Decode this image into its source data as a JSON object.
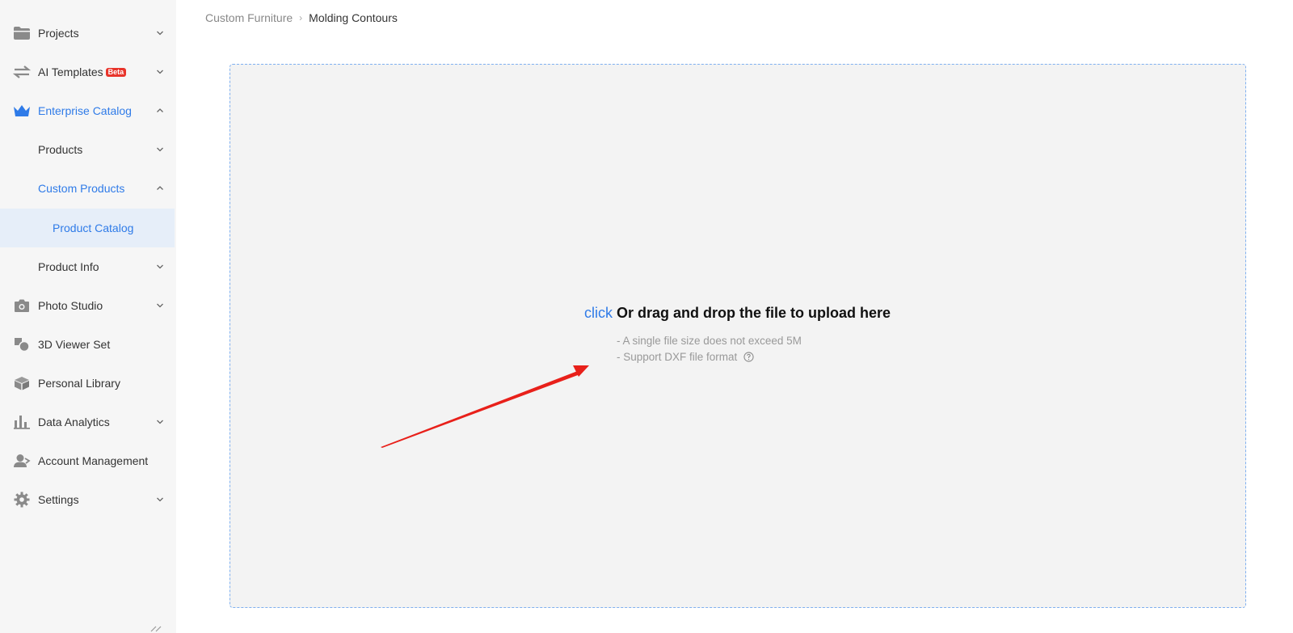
{
  "sidebar": {
    "items": [
      {
        "label": "Projects",
        "icon": "folder-icon"
      },
      {
        "label": "AI Templates",
        "badge": "Beta",
        "icon": "split-arrows-icon"
      },
      {
        "label": "Enterprise Catalog",
        "icon": "crown-icon"
      },
      {
        "label": "Products"
      },
      {
        "label": "Custom Products"
      },
      {
        "label": "Product Catalog"
      },
      {
        "label": "Product Info"
      },
      {
        "label": "Photo Studio",
        "icon": "camera-icon"
      },
      {
        "label": "3D Viewer Set",
        "icon": "shapes-icon"
      },
      {
        "label": "Personal Library",
        "icon": "cube-icon"
      },
      {
        "label": "Data Analytics",
        "icon": "bar-chart-icon"
      },
      {
        "label": "Account Management",
        "icon": "user-icon"
      },
      {
        "label": "Settings",
        "icon": "gear-icon"
      }
    ]
  },
  "breadcrumb": {
    "items": [
      "Custom Furniture",
      "Molding Contours"
    ],
    "separator": "›"
  },
  "upload": {
    "click_label": "click",
    "title": "Or drag and drop the file to upload here",
    "hints": [
      "- A single file size does not exceed 5M",
      "- Support DXF file format"
    ]
  },
  "colors": {
    "accent": "#2f7be8",
    "badge": "#e8342b",
    "annotation_arrow": "#e8201a"
  }
}
